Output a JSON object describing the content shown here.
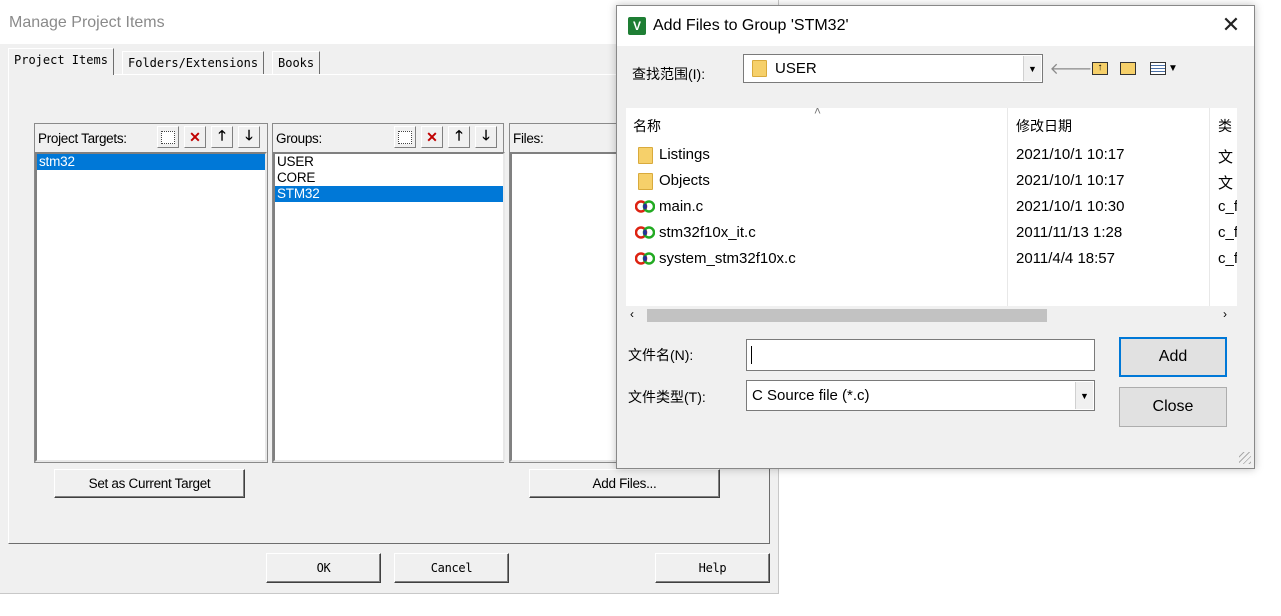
{
  "manage_dialog": {
    "title": "Manage Project Items",
    "tabs": [
      "Project Items",
      "Folders/Extensions",
      "Books"
    ],
    "targets": {
      "header": "Project Targets:",
      "items": [
        "stm32"
      ],
      "selected": "stm32"
    },
    "groups": {
      "header": "Groups:",
      "items": [
        "USER",
        "CORE",
        "STM32"
      ],
      "selected": "STM32"
    },
    "files": {
      "header": "Files:"
    },
    "buttons": {
      "set_target": "Set as Current Target",
      "add_files": "Add Files...",
      "ok": "OK",
      "cancel": "Cancel",
      "help": "Help"
    },
    "toolbar_icons": [
      "new-icon",
      "delete-icon",
      "move-up-icon",
      "move-down-icon"
    ]
  },
  "add_files_dialog": {
    "title": "Add Files to Group 'STM32'",
    "look_in_label": "查找范围(I):",
    "look_in_value": "USER",
    "columns": {
      "name": "名称",
      "date": "修改日期",
      "type": "类"
    },
    "files": [
      {
        "name": "Listings",
        "date": "2021/10/1 10:17",
        "type": "文",
        "icon": "folder-icon"
      },
      {
        "name": "Objects",
        "date": "2021/10/1 10:17",
        "type": "文",
        "icon": "folder-icon"
      },
      {
        "name": "main.c",
        "date": "2021/10/1 10:30",
        "type": "c_f",
        "icon": "c-file-icon"
      },
      {
        "name": "stm32f10x_it.c",
        "date": "2011/11/13 1:28",
        "type": "c_f",
        "icon": "c-file-icon"
      },
      {
        "name": "system_stm32f10x.c",
        "date": "2011/4/4 18:57",
        "type": "c_f",
        "icon": "c-file-icon"
      }
    ],
    "filename_label": "文件名(N):",
    "filename_value": "",
    "filetype_label": "文件类型(T):",
    "filetype_value": "C Source file (*.c)",
    "buttons": {
      "add": "Add",
      "close": "Close"
    }
  }
}
